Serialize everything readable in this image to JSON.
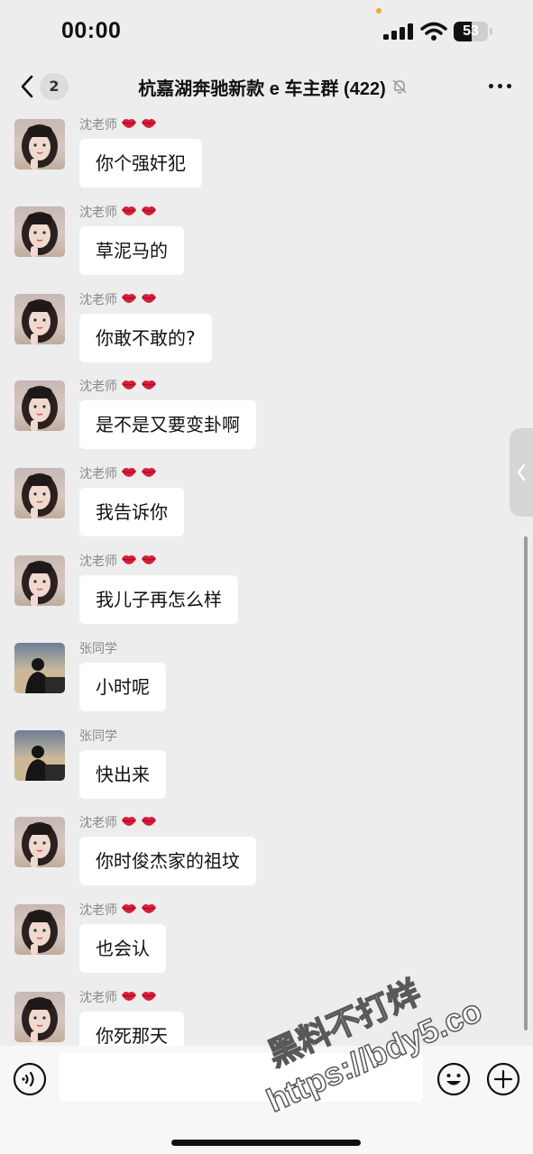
{
  "status_bar": {
    "time": "00:00",
    "battery_level": "53"
  },
  "nav": {
    "unread_count": "2",
    "title": "杭嘉湖奔驰新款 e 车主群 (422)"
  },
  "messages": [
    {
      "sender": "沈老师",
      "avatar": "girl",
      "lips": true,
      "text": "你个强奸犯"
    },
    {
      "sender": "沈老师",
      "avatar": "girl",
      "lips": true,
      "text": "草泥马的"
    },
    {
      "sender": "沈老师",
      "avatar": "girl",
      "lips": true,
      "text": "你敢不敢的?"
    },
    {
      "sender": "沈老师",
      "avatar": "girl",
      "lips": true,
      "text": "是不是又要变卦啊"
    },
    {
      "sender": "沈老师",
      "avatar": "girl",
      "lips": true,
      "text": "我告诉你"
    },
    {
      "sender": "沈老师",
      "avatar": "girl",
      "lips": true,
      "text": "我儿子再怎么样"
    },
    {
      "sender": "张同学",
      "avatar": "boy",
      "lips": false,
      "text": "小时呢"
    },
    {
      "sender": "张同学",
      "avatar": "boy",
      "lips": false,
      "text": "快出来"
    },
    {
      "sender": "沈老师",
      "avatar": "girl",
      "lips": true,
      "text": "你时俊杰家的祖坟"
    },
    {
      "sender": "沈老师",
      "avatar": "girl",
      "lips": true,
      "text": "也会认"
    },
    {
      "sender": "沈老师",
      "avatar": "girl",
      "lips": true,
      "text": "你死那天"
    }
  ],
  "input": {
    "placeholder": ""
  },
  "watermark": {
    "line1": "黑料不打烊",
    "line2": "https://bdy5.co"
  },
  "icons": {
    "back": "chevron-left-icon",
    "mute": "bell-off-icon",
    "more": "more-dots-icon",
    "voice": "voice-icon",
    "emoji": "smiley-icon",
    "plus": "plus-circle-icon",
    "lips": "lips-emoji-icon",
    "side_tab": "chevron-left-icon"
  },
  "colors": {
    "background": "#ededed",
    "bubble": "#ffffff",
    "lips": "#d81e3a",
    "input_bar": "#f7f7f7"
  }
}
